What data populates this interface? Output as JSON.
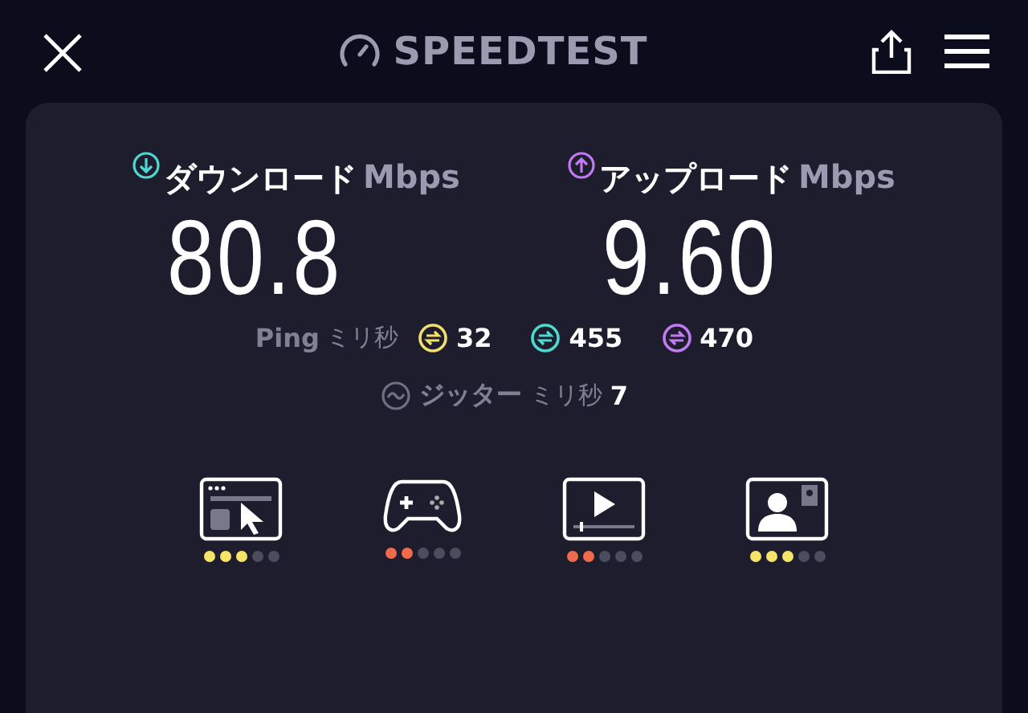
{
  "header": {
    "title": "SPEEDTEST"
  },
  "results": [
    {
      "kind": "download",
      "label": "ダウンロード",
      "unit": "Mbps",
      "value": "80.8",
      "color": "#4fd8d0"
    },
    {
      "kind": "upload",
      "label": "アップロード",
      "unit": "Mbps",
      "value": "9.60",
      "color": "#c27af0"
    }
  ],
  "ping": {
    "label": "Ping",
    "unit": "ミリ秒",
    "readings": [
      {
        "value": "32",
        "color": "#f2de6a"
      },
      {
        "value": "455",
        "color": "#4fd8d0"
      },
      {
        "value": "470",
        "color": "#c27af0"
      }
    ]
  },
  "jitter": {
    "label": "ジッター",
    "unit": "ミリ秒",
    "value": "7"
  },
  "ratings": [
    {
      "kind": "browsing",
      "stars": 3,
      "color": "#f5e46a"
    },
    {
      "kind": "gaming",
      "stars": 2,
      "color": "#f06a4c"
    },
    {
      "kind": "video",
      "stars": 2,
      "color": "#f06a4c"
    },
    {
      "kind": "call",
      "stars": 3,
      "color": "#f5e46a"
    }
  ]
}
